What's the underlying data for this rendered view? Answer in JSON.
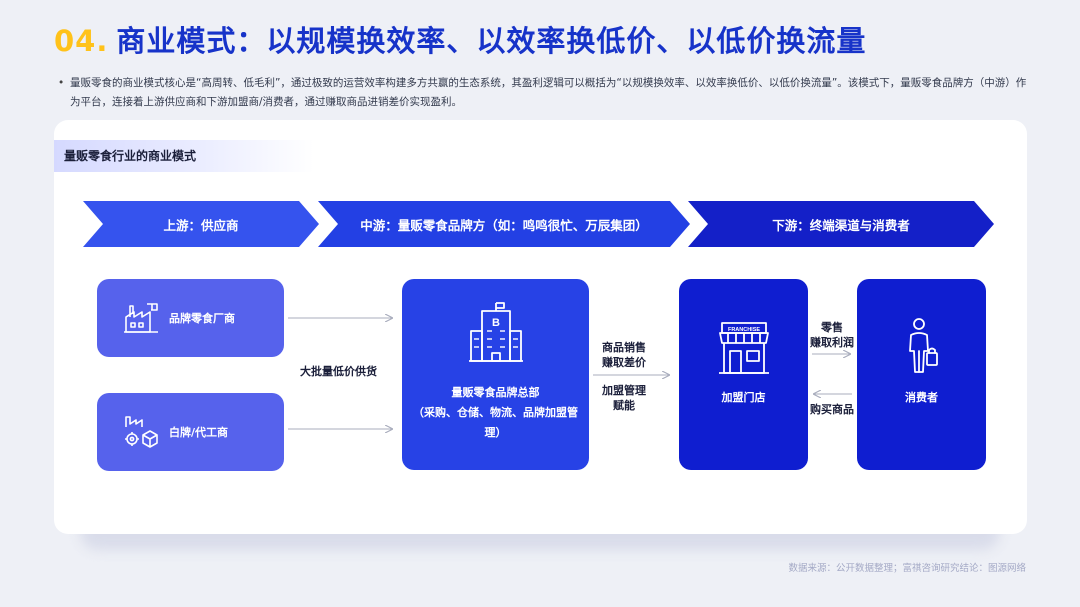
{
  "header": {
    "number": "04.",
    "title": "商业模式：以规模换效率、以效率换低价、以低价换流量"
  },
  "intro": "量贩零食的商业模式核心是“高周转、低毛利”，通过极致的运营效率构建多方共赢的生态系统，其盈利逻辑可以概括为“以规模换效率、以效率换低价、以低价换流量”。该模式下，量贩零食品牌方（中游）作为平台，连接着上游供应商和下游加盟商/消费者，通过赚取商品进销差价实现盈利。",
  "diagram": {
    "tag": "量贩零食行业的商业模式",
    "stages": {
      "upstream": "上游：供应商",
      "midstream": "中游：量贩零食品牌方（如：鸣鸣很忙、万辰集团）",
      "downstream": "下游：终端渠道与消费者"
    },
    "nodes": {
      "brand_maker": "品牌零食厂商",
      "white_label": "白牌/代工商",
      "hq_title": "量贩零食品牌总部",
      "hq_detail": "（采购、仓储、物流、品牌加盟管理）",
      "store": "加盟门店",
      "consumer": "消费者",
      "store_sign": "FRANCHISE",
      "hq_sign": "B"
    },
    "notes": {
      "supply": "大批量低价供货",
      "sales_line1": "商品销售",
      "sales_line2": "赚取差价",
      "franchise_line1": "加盟管理",
      "franchise_line2": "赋能",
      "retail_line1": "零售",
      "retail_line2": "赚取利润",
      "purchase": "购买商品"
    }
  },
  "source": "数据来源：公开数据整理；富祺咨询研究结论：图源网络",
  "colors": {
    "title": "#1733c9",
    "number": "#ffc21a",
    "stage1": "#3553ee",
    "stage2": "#2340e4",
    "stage3": "#1420c8"
  }
}
